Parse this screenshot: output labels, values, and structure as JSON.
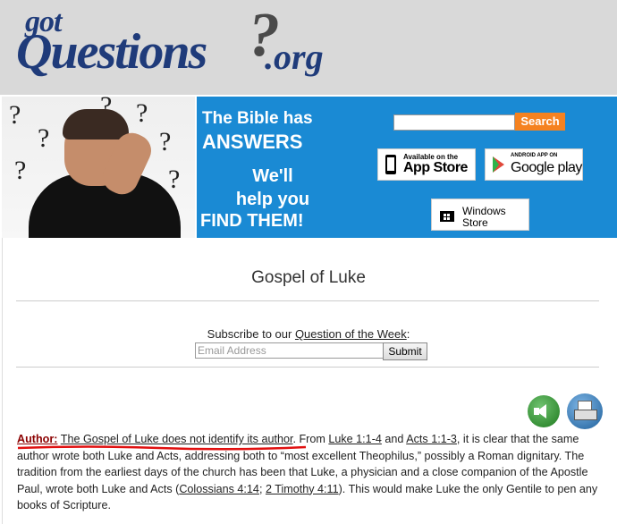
{
  "header": {
    "logo_got": "got",
    "logo_questions": "Questions",
    "logo_qmark": "?",
    "logo_org": ".org"
  },
  "banner": {
    "tagline_line1": "The Bible has",
    "tagline_line2": "ANSWERS",
    "tagline_line3": "We'll",
    "tagline_line4": "help you",
    "tagline_line5": "FIND THEM!",
    "search_placeholder": "",
    "search_button": "Search",
    "app_store_small": "Available on the",
    "app_store_big": "App Store",
    "google_play_small": "ANDROID APP ON",
    "google_play_big": "Google play",
    "windows_store_line1": "Windows",
    "windows_store_line2": "Store",
    "brand_blue": "#1a8ad4",
    "search_orange": "#f58220"
  },
  "page": {
    "title": "Gospel of Luke",
    "subscribe_prefix": "Subscribe to our ",
    "subscribe_link": "Question of the Week",
    "subscribe_suffix": ":",
    "email_placeholder": "Email Address",
    "submit_label": "Submit"
  },
  "tools": {
    "audio_icon": "speaker-icon",
    "print_icon": "printer-icon"
  },
  "article": {
    "author_label": "Author:",
    "author_claim": "The Gospel of Luke does not identify its author",
    "text1": ". From ",
    "ref1": "Luke 1:1-4",
    "text2": " and ",
    "ref2": "Acts 1:1-3",
    "text3": ", it is clear that the same author wrote both Luke and Acts, addressing both to “most excellent Theophilus,” possibly a Roman dignitary. The tradition from the earliest days of the church has been that Luke, a physician and a close companion of the Apostle Paul, wrote both Luke and Acts (",
    "ref3": "Colossians 4:14",
    "text4": "; ",
    "ref4": "2 Timothy 4:11",
    "text5": "). This would make Luke the only Gentile to pen any books of Scripture."
  }
}
